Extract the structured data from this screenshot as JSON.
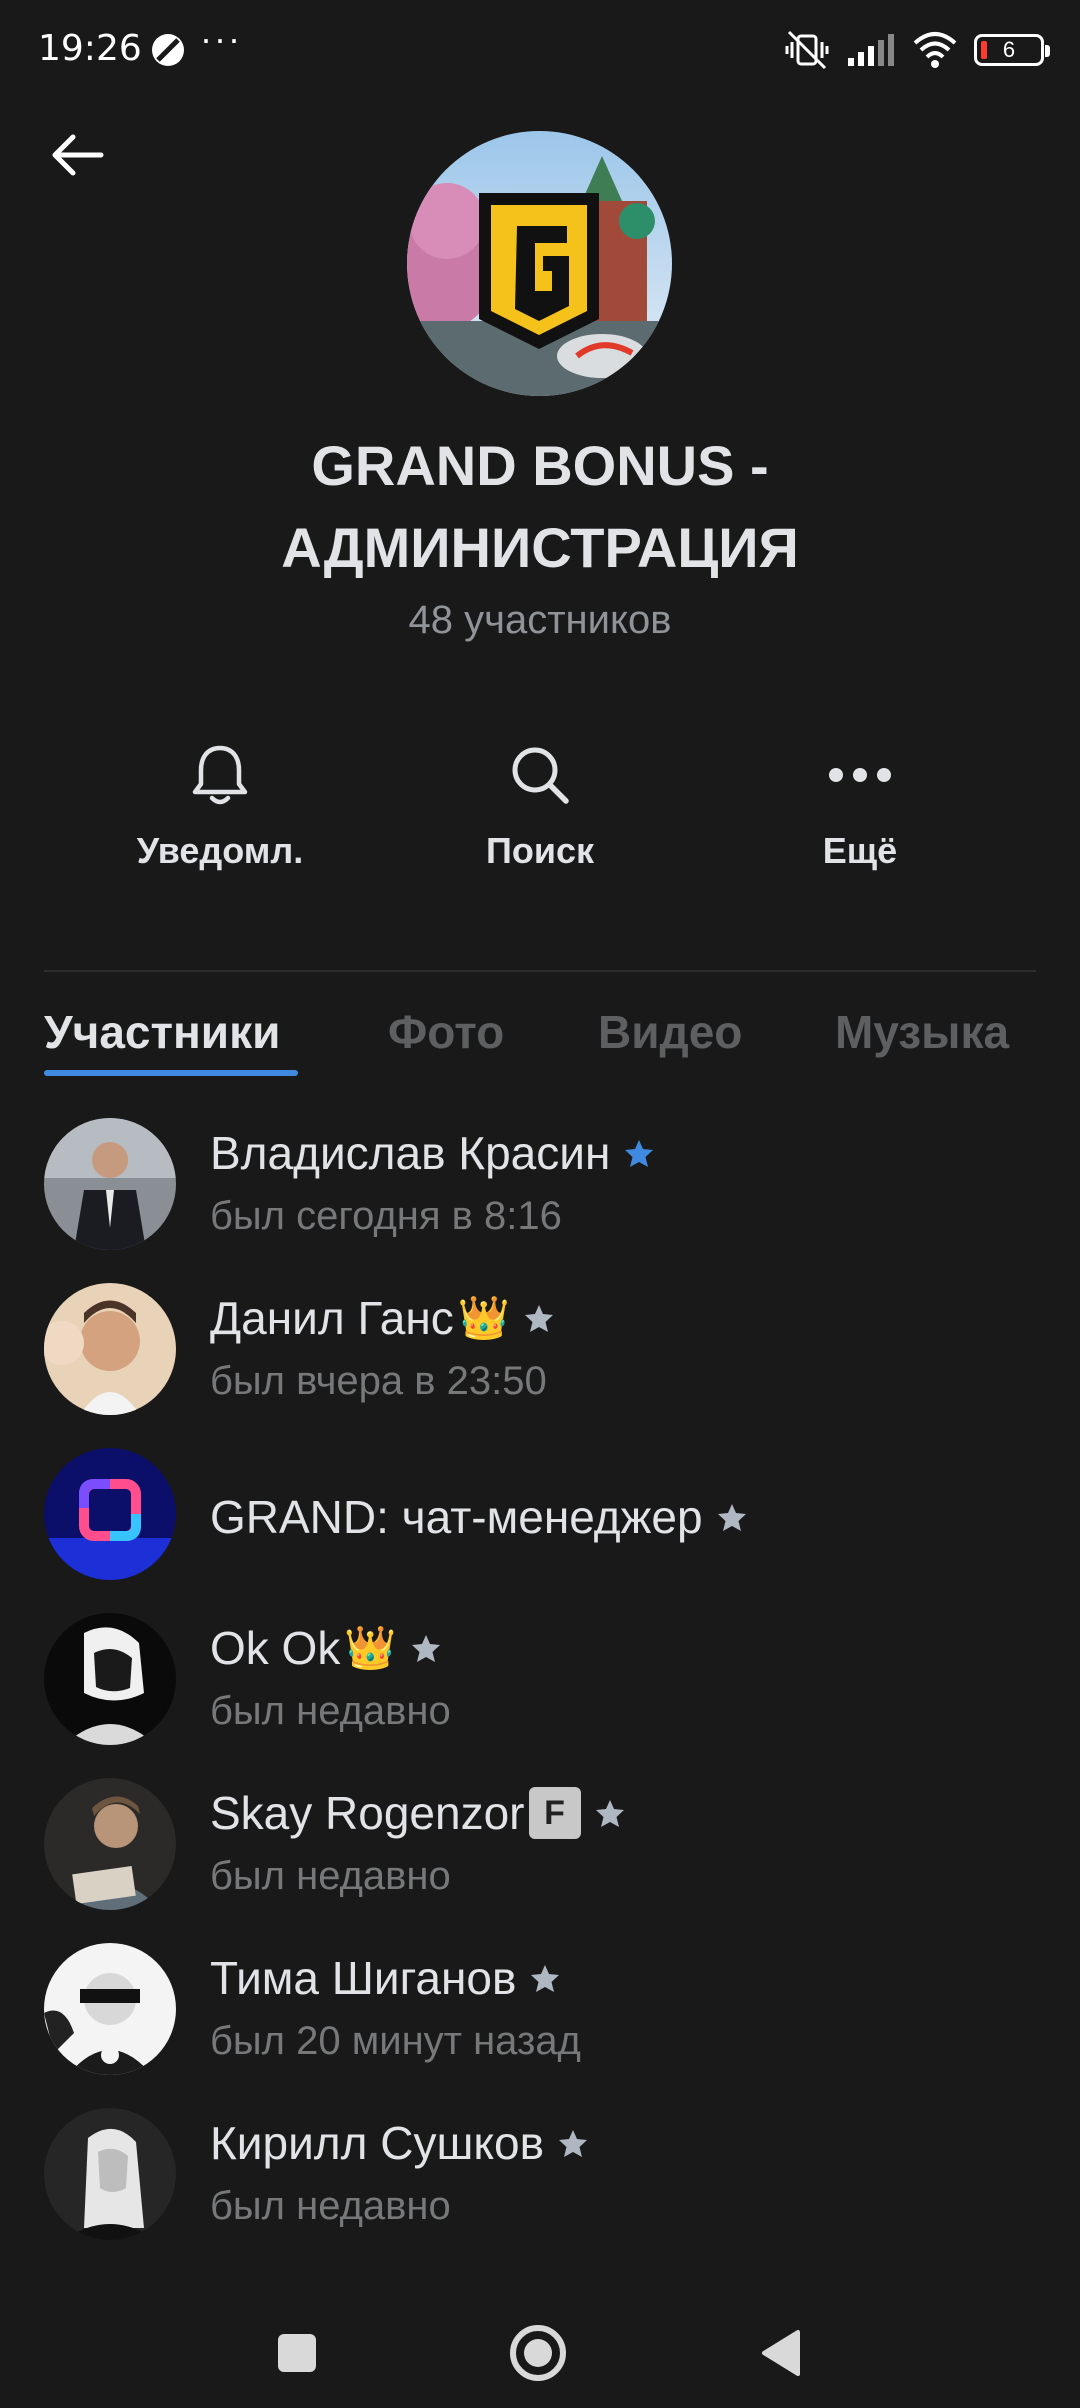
{
  "status_bar": {
    "time": "19:26",
    "dots": "···",
    "battery": "6"
  },
  "header": {
    "title": "GRAND BONUS - АДМИНИСТРАЦИЯ",
    "members_count": "48 участников"
  },
  "actions": [
    {
      "label": "Уведомл.",
      "icon": "bell-icon"
    },
    {
      "label": "Поиск",
      "icon": "search-icon"
    },
    {
      "label": "Ещё",
      "icon": "more-icon"
    }
  ],
  "tabs": [
    {
      "label": "Участники",
      "active": true
    },
    {
      "label": "Фото",
      "active": false
    },
    {
      "label": "Видео",
      "active": false
    },
    {
      "label": "Музыка",
      "active": false
    }
  ],
  "members": [
    {
      "name": "Владислав Красин",
      "status": "был сегодня в 8:16",
      "star_color": "#3f8ae0"
    },
    {
      "name": "Данил Ганс",
      "emoji": "👑",
      "status": "был вчера в 23:50",
      "star_color": "#aeb7c2"
    },
    {
      "name": "GRAND: чат-менеджер",
      "status": "",
      "star_color": "#aeb7c2"
    },
    {
      "name": "Ok Ok",
      "emoji": "👑",
      "status": "был недавно",
      "star_color": "#aeb7c2"
    },
    {
      "name": "Skay Rogenzor",
      "badge": "F",
      "status": "был недавно",
      "star_color": "#aeb7c2"
    },
    {
      "name": "Тима Шиганов",
      "status": "был 20 минут назад",
      "star_color": "#aeb7c2"
    },
    {
      "name": "Кирилл Сушков",
      "status": "был недавно",
      "star_color": "#aeb7c2"
    }
  ],
  "colors": {
    "background": "#191919",
    "accent": "#3f8ae0",
    "text_primary": "#e1e3e6",
    "text_secondary": "#76787a"
  }
}
